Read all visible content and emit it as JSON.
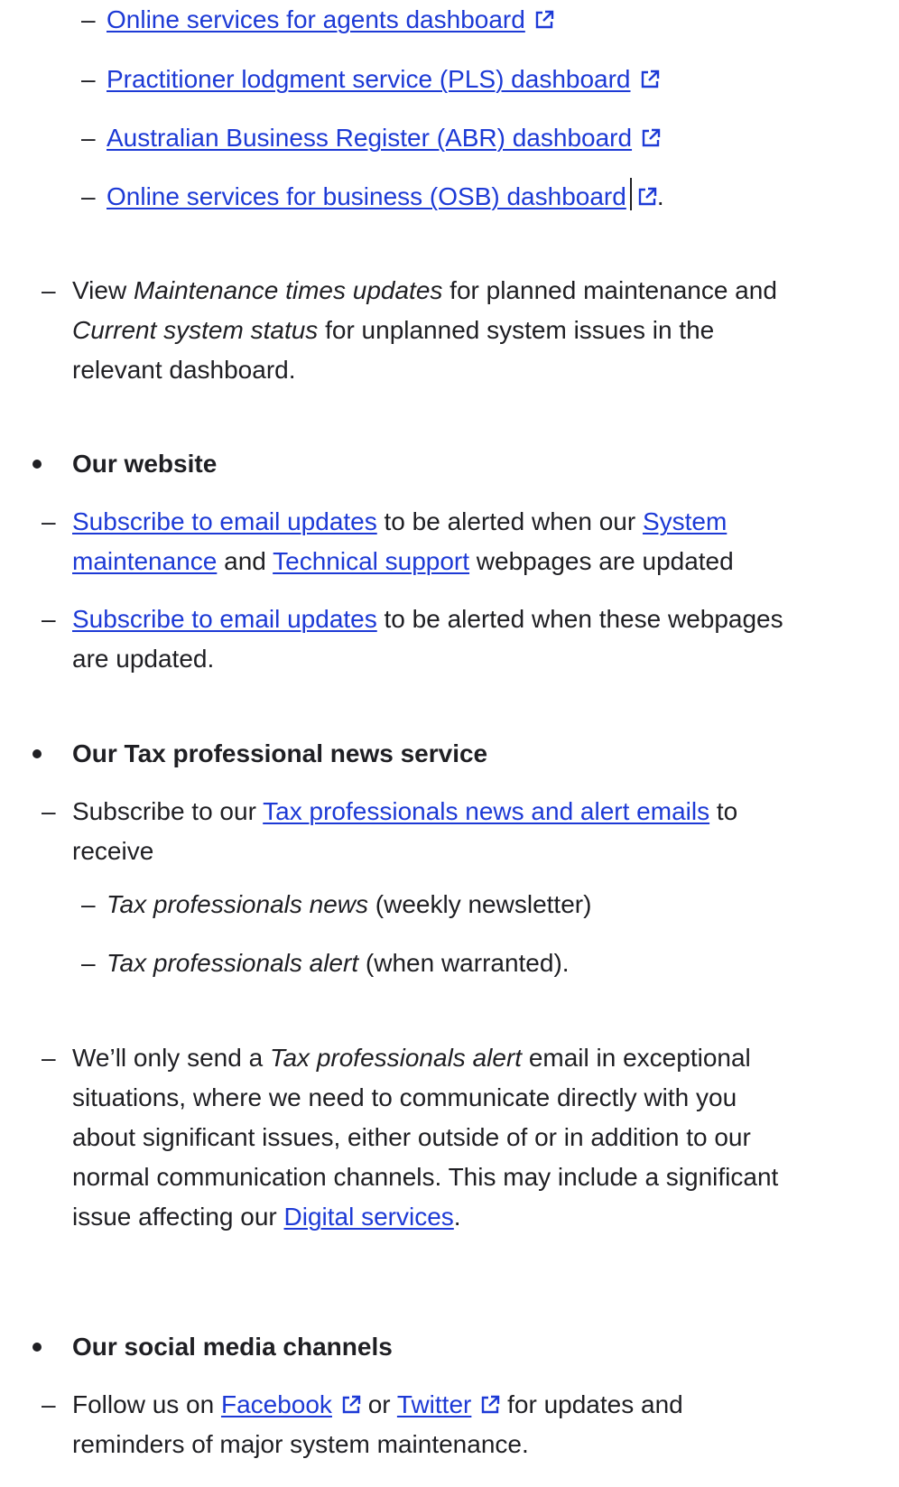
{
  "accent_color": "#1d3ad6",
  "dashboards": {
    "items": [
      {
        "label": "Online services for agents dashboard",
        "suffix": ""
      },
      {
        "label": "Practitioner lodgment service (PLS) dashboard",
        "suffix": ""
      },
      {
        "label": "Australian Business Register (ABR) dashboard",
        "suffix": ""
      },
      {
        "label": "Online services for business (OSB) dashboard",
        "suffix": "."
      }
    ],
    "view_note": {
      "p1": "View ",
      "em1": "Maintenance times updates",
      "p2": " for planned maintenance and",
      "em2": "Current system status",
      "p3": " for unplanned system issues in the",
      "p4": "relevant dashboard."
    }
  },
  "website": {
    "heading": "Our website",
    "item1": {
      "link1": "Subscribe to email updates",
      "t1": " to be alerted when our ",
      "link2a": "System",
      "link2b": "maintenance",
      "t2": " and ",
      "link3": "Technical support",
      "t3": " webpages are updated"
    },
    "item2": {
      "link1": "Subscribe to email updates",
      "t1": " to be alerted when these webpages",
      "t2": "are updated."
    }
  },
  "news": {
    "heading": "Our Tax professional news service",
    "item1": {
      "t1": "Subscribe to our ",
      "link1": "Tax professionals news and alert emails",
      "t2": " to",
      "t3": "receive"
    },
    "sub": [
      {
        "em": "Tax professionals news",
        "rest": " (weekly newsletter)"
      },
      {
        "em": "Tax professionals alert",
        "rest": " (when warranted)."
      }
    ],
    "item2": {
      "l1a": "We’ll only send a ",
      "l1em": "Tax professionals alert",
      "l1b": " email in exceptional",
      "l2": "situations, where we need to communicate directly with you",
      "l3": "about significant issues, either outside of or in addition to our",
      "l4": "normal communication channels. This may include a significant",
      "l5a": "issue affecting our ",
      "l5link": "Digital services",
      "l5b": "."
    }
  },
  "social": {
    "heading": "Our social media channels",
    "item1": {
      "t1": "Follow us on ",
      "link1": "Facebook",
      "t2": " or ",
      "link2": "Twitter",
      "t3": " for updates and",
      "t4": "reminders of major system maintenance."
    }
  },
  "icons": {
    "external": "external-link-icon",
    "bullet": "bullet-icon"
  }
}
